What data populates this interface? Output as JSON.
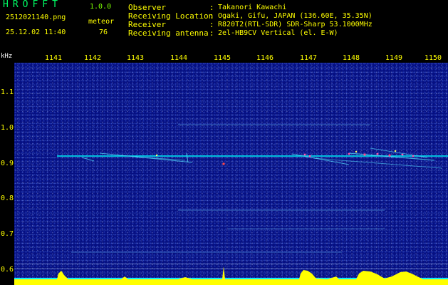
{
  "header": {
    "logo": "HROFFT",
    "version": "1.0.0",
    "filename": "2512021140.png",
    "datetime": "25.12.02 11:40",
    "meteor_label": "meteor",
    "meteor_count": "76",
    "info": [
      {
        "label": "Observer",
        "value": "Takanori Kawachi"
      },
      {
        "label": "Receiving Location",
        "value": "Ogaki, Gifu, JAPAN (136.60E, 35.35N)"
      },
      {
        "label": "Receiver",
        "value": "R820T2(RTL-SDR) SDR-Sharp 53.1000MHz"
      },
      {
        "label": "Receiving antenna",
        "value": "2el-HB9CV Vertical (el. E-W)"
      }
    ],
    "separator": ":"
  },
  "axes": {
    "y_unit": "kHz",
    "x_ticks": [
      "1141",
      "1142",
      "1143",
      "1144",
      "1145",
      "1146",
      "1147",
      "1148",
      "1149",
      "1150"
    ],
    "y_ticks": [
      "1.1",
      "1.0",
      "0.9",
      "0.8",
      "0.7",
      "0.6"
    ]
  },
  "colors": {
    "background": "#061082",
    "label": "#ffff00",
    "signal": "#00ffff",
    "spectrum": "#ffff00"
  },
  "chart_data": {
    "type": "heatmap",
    "x_ticks": [
      1141,
      1142,
      1143,
      1144,
      1145,
      1146,
      1147,
      1148,
      1149,
      1150
    ],
    "ylabel": "kHz",
    "y_ticks": [
      1.1,
      1.0,
      0.9,
      0.8,
      0.7,
      0.6
    ],
    "ylim": [
      0.58,
      1.2
    ],
    "xlim": [
      1140.6,
      1150.3
    ],
    "carrier_lines_khz": [
      0.92,
      0.95,
      0.78,
      0.725,
      0.66
    ],
    "meteor_count": 76
  }
}
